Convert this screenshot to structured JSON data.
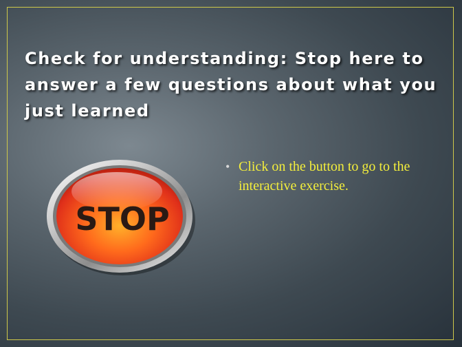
{
  "slide": {
    "title": "Check for understanding: Stop here to answer a few questions about what you just learned",
    "bullets": [
      "Click on the button to go to the interactive exercise."
    ],
    "stop_button": {
      "label": "STOP",
      "icon": "stop-sign-icon"
    }
  },
  "colors": {
    "frame_border": "#cfc94a",
    "title_text": "#ffffff",
    "bullet_text": "#f3ee3c",
    "stop_red": "#e8321a",
    "stop_orange": "#ff9a1e"
  }
}
